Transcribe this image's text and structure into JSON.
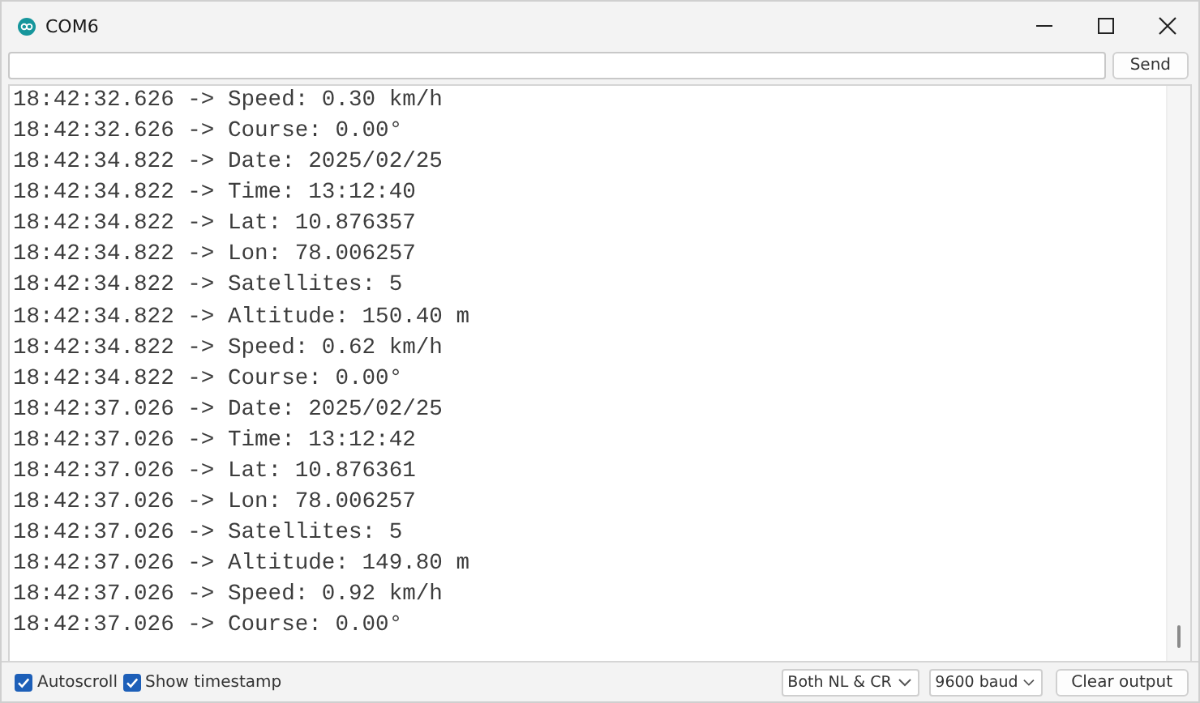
{
  "window": {
    "title": "COM6"
  },
  "send_button": "Send",
  "output_lines": [
    "18:42:32.626 -> Speed: 0.30 km/h",
    "18:42:32.626 -> Course: 0.00°",
    "18:42:34.822 -> Date: 2025/02/25",
    "18:42:34.822 -> Time: 13:12:40",
    "18:42:34.822 -> Lat: 10.876357",
    "18:42:34.822 -> Lon: 78.006257",
    "18:42:34.822 -> Satellites: 5",
    "18:42:34.822 -> Altitude: 150.40 m",
    "18:42:34.822 -> Speed: 0.62 km/h",
    "18:42:34.822 -> Course: 0.00°",
    "18:42:37.026 -> Date: 2025/02/25",
    "18:42:37.026 -> Time: 13:12:42",
    "18:42:37.026 -> Lat: 10.876361",
    "18:42:37.026 -> Lon: 78.006257",
    "18:42:37.026 -> Satellites: 5",
    "18:42:37.026 -> Altitude: 149.80 m",
    "18:42:37.026 -> Speed: 0.92 km/h",
    "18:42:37.026 -> Course: 0.00°"
  ],
  "footer": {
    "checkboxes": [
      {
        "label": "Autoscroll",
        "checked": true
      },
      {
        "label": "Show timestamp",
        "checked": true
      }
    ],
    "line_ending": "Both NL & CR",
    "baud_rate": "9600 baud",
    "clear_button": "Clear output"
  }
}
